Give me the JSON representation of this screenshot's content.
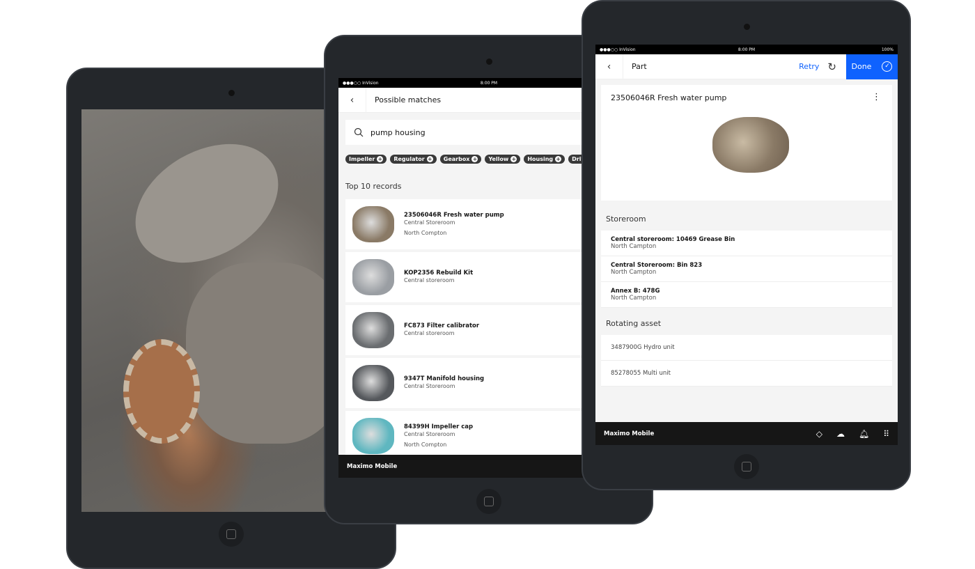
{
  "status": {
    "carrier": "●●●○○ InVision",
    "time": "8:00 PM",
    "battery": "100%"
  },
  "matches": {
    "title": "Possible matches",
    "search": {
      "value": "pump housing",
      "icon": "search-icon"
    },
    "chips": [
      "Impeller",
      "Regulator",
      "Gearbox",
      "Yellow",
      "Housing",
      "Drive shaft"
    ],
    "section": "Top 10 records",
    "records": [
      {
        "title": "23506046R Fresh water pump",
        "lines": [
          "Central Storeroom",
          "North Compton"
        ],
        "color": "#8a7a66"
      },
      {
        "title": "KOP2356 Rebuild Kit",
        "lines": [
          "Central storeroom"
        ],
        "color": "#9a9ea3"
      },
      {
        "title": "FC873 Filter calibrator",
        "lines": [
          "Central storeroom"
        ],
        "color": "#6a6d70"
      },
      {
        "title": "9347T Manifold housing",
        "lines": [
          "Central Storeroom"
        ],
        "color": "#55585c"
      },
      {
        "title": "84399H Impeller cap",
        "lines": [
          "Central Storeroom",
          "North Compton"
        ],
        "color": "#5fb7c0"
      }
    ],
    "app": "Maximo Mobile"
  },
  "part": {
    "title": "Part",
    "retry": "Retry",
    "done": "Done",
    "accent": "#0f62fe",
    "name": "23506046R Fresh water pump",
    "storeroom_label": "Storeroom",
    "storerooms": [
      {
        "name": "Central storeroom: 10469 Grease Bin",
        "site": "North Campton"
      },
      {
        "name": "Central Storeroom: Bin 823",
        "site": "North Campton"
      },
      {
        "name": "Annex B: 478G",
        "site": "North Campton"
      }
    ],
    "asset_label": "Rotating asset",
    "assets": [
      "3487900G Hydro unit",
      "85278055 Multi unit"
    ],
    "app": "Maximo Mobile"
  }
}
